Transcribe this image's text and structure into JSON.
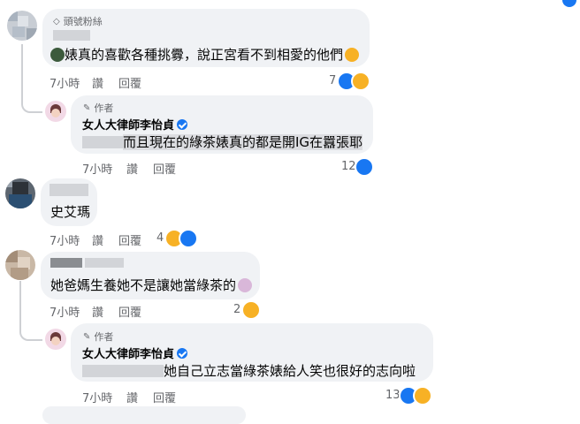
{
  "comments": [
    {
      "badge": "頭號粉絲",
      "text": "婊真的喜歡各種挑釁，說正宮看不到相愛的他們",
      "meta": {
        "time": "7小時",
        "like": "讚",
        "reply": "回覆"
      },
      "reaction_count": "7",
      "reactions": [
        "like-icon",
        "haha-icon"
      ]
    },
    {
      "author_label": "作者",
      "name": "女人大律師李怡貞",
      "text": "而且現在的綠茶婊真的都是開IG在囂張耶",
      "meta": {
        "time": "7小時",
        "like": "讚",
        "reply": "回覆"
      },
      "reaction_count": "12",
      "reactions": [
        "like-icon"
      ]
    },
    {
      "text": "史艾瑪",
      "meta": {
        "time": "7小時",
        "like": "讚",
        "reply": "回覆"
      },
      "reaction_count": "4",
      "reactions": [
        "haha-icon",
        "like-icon"
      ]
    },
    {
      "text": "她爸媽生養她不是讓她當綠茶的",
      "meta": {
        "time": "7小時",
        "like": "讚",
        "reply": "回覆"
      },
      "reaction_count": "2",
      "reactions": [
        "haha-icon"
      ]
    },
    {
      "author_label": "作者",
      "name": "女人大律師李怡貞",
      "text": "她自己立志當綠茶婊給人笑也很好的志向啦",
      "meta": {
        "time": "7小時",
        "like": "讚",
        "reply": "回覆"
      },
      "reaction_count": "13",
      "reactions": [
        "like-icon",
        "haha-icon"
      ]
    }
  ],
  "colors": {
    "like": "#1877f2",
    "haha": "#f7b125",
    "bubble": "#f0f2f5",
    "meta_text": "#65676b"
  }
}
